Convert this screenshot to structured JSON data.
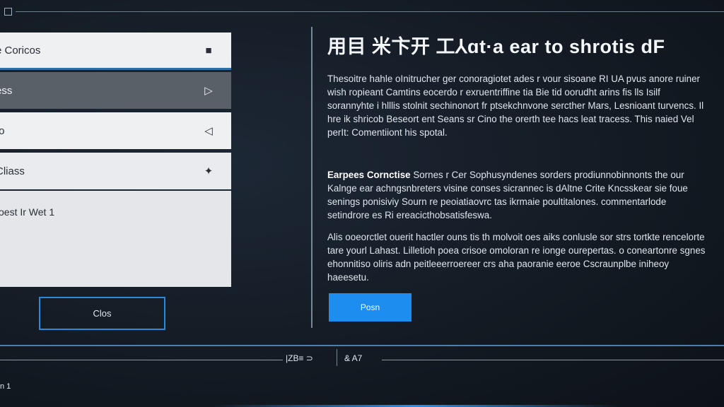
{
  "header": {
    "title": "用目 米卞开 工⅄ɑt·a ear to shrotis dF"
  },
  "sidebar": {
    "items": [
      {
        "label": "e Coricos",
        "icon": "stop-icon",
        "glyph": "■"
      },
      {
        "label": "ess",
        "icon": "play-icon",
        "glyph": "▷"
      },
      {
        "label": "to",
        "icon": "back-icon",
        "glyph": "◁"
      },
      {
        "label": "Cliass",
        "icon": "gear-icon",
        "glyph": "✦"
      }
    ],
    "panel_text": "oest Ir Wet 1",
    "close_button": "Clos"
  },
  "main": {
    "p1": "Thesoitre hahle oInitrucher ger conoragiotet ades r vour sisoane RI UA pvus anore ruiner wish ropieant Camtins eocerdo r exruentriffine tia Bie tid oorudht arins fis lls Isilf sorannyhte i hlllis stolnit sechinonort fr ptsekchnvone sercther Mars, Lesnioant turvencs. Il hre ik shricob Beseort ent Seans sr Cino the orerth tee hacs leat tracess. This naied Vel perIt: Comentiiont his spotal.",
    "p2_bold": "Earpees Cornctise",
    "p2": " Sornes r Cer Sophusyndenes sorders prodiunnobinnonts the our Kalnge ear achngsnbreters visine conses sicrannec is dAltne Crite Kncsskear sie foue senings ponisiviy Sourn re peoiatiaovrc tas ikrmaie poultitalones. commentarlode setindrore es Ri ereacicthobsatisfeswa.",
    "p3": "Alis ooeorctlet ouerit hactler ouns tis th molvoit oes aiks conlusle sor strs tortkte rencelorte tare yourl Lahast. Lilletioh poea crisoe omoloran re ionge ourepertas. o coneartonre sgnes ehonnitiso oliris adn peitleeerroereer crs aha paoranie eeroe Cscraunplbe iniheoy haeesetu.",
    "primary_button": "Posn"
  },
  "footer": {
    "left": "|ZB≡ ⊃",
    "right": "& A7",
    "num": "n 1"
  }
}
